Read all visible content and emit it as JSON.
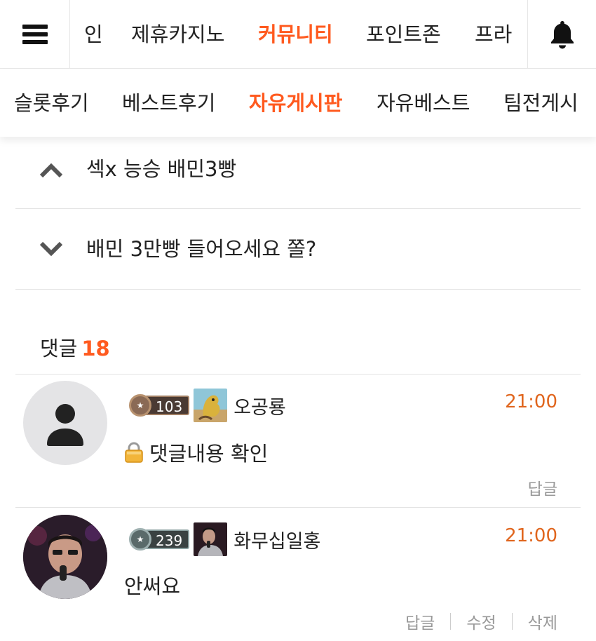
{
  "topnav": {
    "items": [
      "인",
      "제휴카지노",
      "커뮤니티",
      "포인트존",
      "프라"
    ],
    "active_index": 2
  },
  "subnav": {
    "items": [
      "슬롯후기",
      "베스트후기",
      "자유게시판",
      "자유베스트",
      "팀전게시"
    ],
    "active_index": 2
  },
  "post_nav": {
    "prev_title": "섹x 능승 배민3빵",
    "next_title": "배민 3만빵 들어오세요 쫄?"
  },
  "comments": {
    "label": "댓글",
    "count": "18",
    "items": [
      {
        "level": "103",
        "nickname": "오공룡",
        "time": "21:00",
        "content": "댓글내용 확인",
        "locked": true,
        "actions": [
          "답글"
        ]
      },
      {
        "level": "239",
        "nickname": "화무십일홍",
        "time": "21:00",
        "content": "안써요",
        "locked": false,
        "actions": [
          "답글",
          "수정",
          "삭제"
        ]
      }
    ]
  },
  "colors": {
    "accent": "#ff5a1f",
    "time": "#e0651d",
    "muted": "#999999"
  }
}
